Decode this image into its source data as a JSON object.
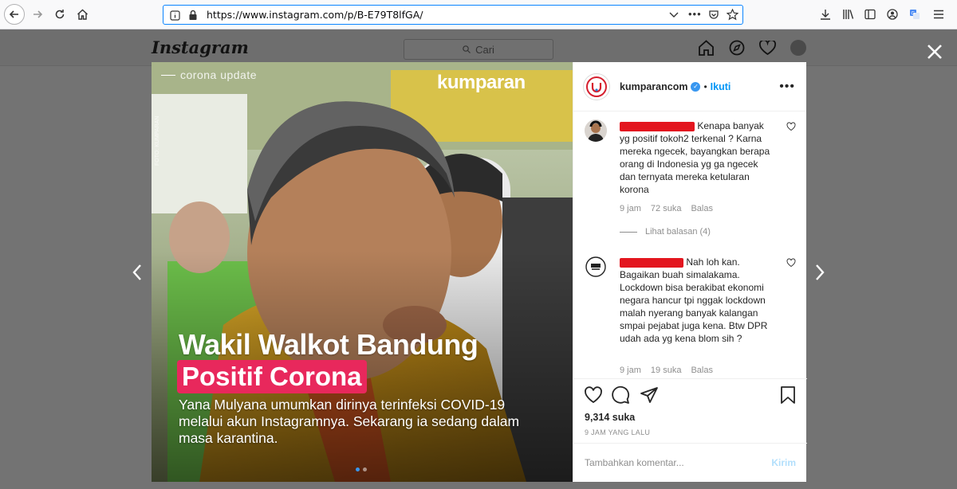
{
  "browser": {
    "url": "https://www.instagram.com/p/B-E79T8lfGA/",
    "back_icon": "back-arrow-icon",
    "forward_icon": "forward-arrow-icon"
  },
  "instagram": {
    "logo": "Instagram",
    "search_placeholder": "Cari"
  },
  "post": {
    "image": {
      "tag": "corona update",
      "brand": "kumparan",
      "photo_credit": "FOTO: KUMPARAN",
      "headline_line1": "Wakil Walkot Bandung",
      "headline_line2": "Positif Corona",
      "subtext": "Yana Mulyana umumkan dirinya terinfeksi COVID-19 melalui akun Instagramnya. Sekarang ia sedang dalam masa karantina.",
      "pager_total": 2,
      "pager_active": 1
    },
    "header": {
      "username": "kumparancom",
      "dot": "•",
      "follow_label": "Ikuti",
      "more_label": "•••"
    },
    "comments": [
      {
        "text": "Kenapa banyak yg positif tokoh2 terkenal ? Karna mereka ngecek, bayangkan berapa orang di Indonesia yg ga ngecek dan ternyata mereka ketularan korona",
        "time": "9 jam",
        "likes": "72 suka",
        "reply": "Balas",
        "view_replies": "Lihat balasan (4)"
      },
      {
        "text": "Nah loh kan. Bagaikan buah simalakama. Lockdown bisa berakibat ekonomi negara hancur tpi nggak lockdown malah nyerang banyak kalangan smpai pejabat juga kena. Btw DPR udah ada yg kena blom sih ?",
        "time": "9 jam",
        "likes": "19 suka",
        "reply": "Balas"
      }
    ],
    "likes": "9,314 suka",
    "time_ago": "9 JAM YANG LALU",
    "add_comment_placeholder": "Tambahkan komentar...",
    "post_button": "Kirim"
  },
  "colors": {
    "accent": "#0095f6",
    "headline_bg": "#e8285c",
    "redaction": "#e3161f"
  }
}
